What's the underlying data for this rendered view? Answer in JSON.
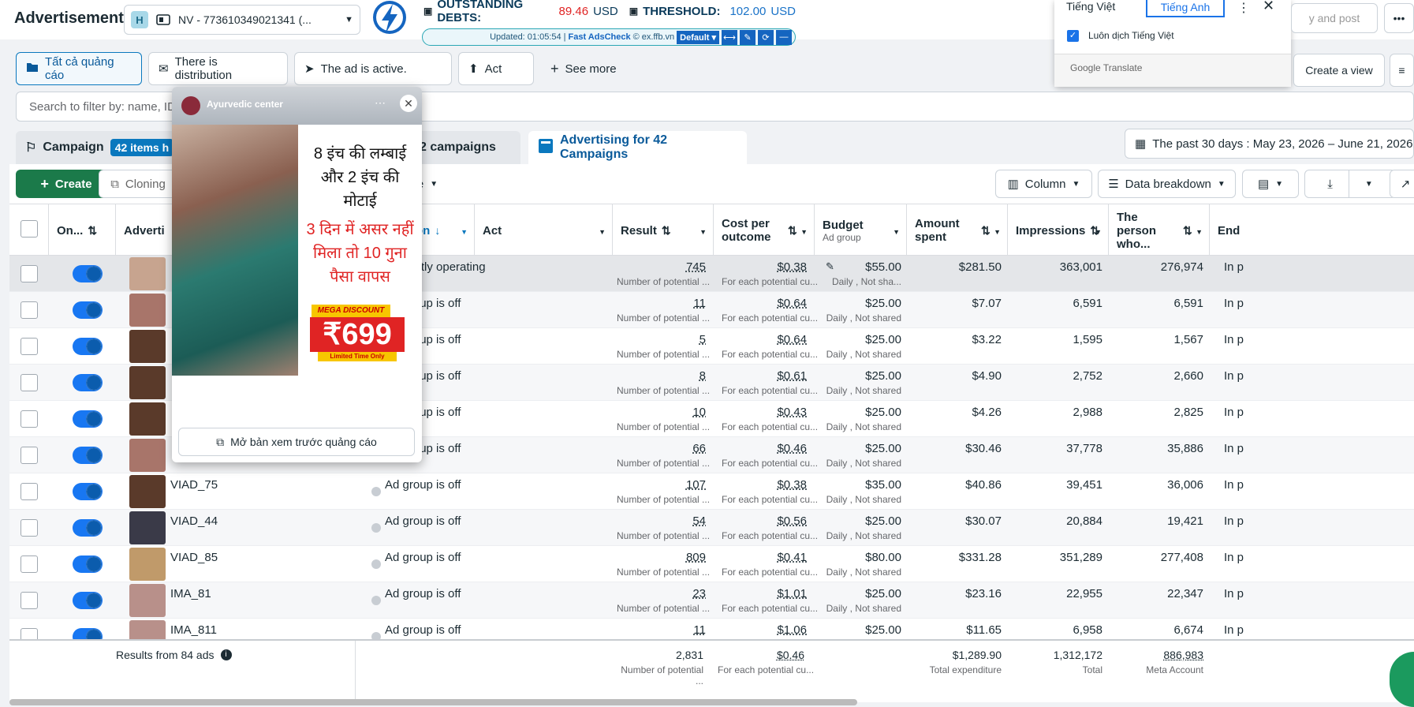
{
  "header": {
    "app_title": "Advertisement",
    "account_badge": "H",
    "account_label": "NV - 773610349021341 (...",
    "right_buttons": [
      "y and post",
      "Create a view"
    ]
  },
  "extension": {
    "debts_label": "OUTSTANDING DEBTS:",
    "debts_value": "89.46",
    "debts_currency": "USD",
    "threshold_label": "THRESHOLD:",
    "threshold_value": "102.00",
    "threshold_currency": "USD",
    "updated_text": "Updated: 01:05:54 |",
    "brand": "Fast AdsCheck",
    "copyright": "© ex.ffb.vn",
    "mode": "Default"
  },
  "translate": {
    "tab_source": "Tiếng Việt",
    "tab_target": "Tiếng Anh",
    "always_translate": "Luôn dịch Tiếng Việt",
    "footer": "Google Translate"
  },
  "filters": {
    "chips": [
      "Tất cả quảng cáo",
      "There is distribution",
      "The ad is active.",
      "Act"
    ],
    "see_more": "See more"
  },
  "search": {
    "placeholder": "Search to filter by: name, ID,..."
  },
  "tabs": {
    "campaign": "Campaign",
    "campaign_badge": "42 items h",
    "adsets": "2 campaigns",
    "ads": "Advertising for 42 Campaigns"
  },
  "date_range": "The past 30 days : May 23, 2026 – June 21, 2026",
  "toolbar": {
    "create": "Create",
    "cloning": "Cloning",
    "more_caret": "e",
    "column": "Column",
    "breakdown": "Data breakdown"
  },
  "columns": {
    "onoff": "On...",
    "ad": "Adverti",
    "distribution": "istribution",
    "act": "Act",
    "result": "Result",
    "cpo": "Cost per outcome",
    "budget": "Budget",
    "budget_sub": "Ad group",
    "spent": "Amount spent",
    "impressions": "Impressions",
    "reach": "The person who...",
    "end": "End"
  },
  "rows": [
    {
      "name": "",
      "status": "Currently operating",
      "result": "745",
      "result_sub": "Number of potential ...",
      "cpo": "$0.38",
      "cpo_sub": "For each potential cu...",
      "budget": "$55.00",
      "budget_sub": "Daily , Not sha...",
      "spent": "$281.50",
      "impr": "363,001",
      "reach": "276,974",
      "end": "In p"
    },
    {
      "name": "",
      "status": "Ad group is off",
      "result": "11",
      "result_sub": "Number of potential ...",
      "cpo": "$0.64",
      "cpo_sub": "For each potential cu...",
      "budget": "$25.00",
      "budget_sub": "Daily , Not shared",
      "spent": "$7.07",
      "impr": "6,591",
      "reach": "6,591",
      "end": "In p"
    },
    {
      "name": "",
      "status": "Ad group is off",
      "result": "5",
      "result_sub": "Number of potential ...",
      "cpo": "$0.64",
      "cpo_sub": "For each potential cu...",
      "budget": "$25.00",
      "budget_sub": "Daily , Not shared",
      "spent": "$3.22",
      "impr": "1,595",
      "reach": "1,567",
      "end": "In p"
    },
    {
      "name": "",
      "status": "Ad group is off",
      "result": "8",
      "result_sub": "Number of potential ...",
      "cpo": "$0.61",
      "cpo_sub": "For each potential cu...",
      "budget": "$25.00",
      "budget_sub": "Daily , Not shared",
      "spent": "$4.90",
      "impr": "2,752",
      "reach": "2,660",
      "end": "In p"
    },
    {
      "name": "",
      "status": "Ad group is off",
      "result": "10",
      "result_sub": "Number of potential ...",
      "cpo": "$0.43",
      "cpo_sub": "For each potential cu...",
      "budget": "$25.00",
      "budget_sub": "Daily , Not shared",
      "spent": "$4.26",
      "impr": "2,988",
      "reach": "2,825",
      "end": "In p"
    },
    {
      "name": "",
      "status": "Ad group is off",
      "result": "66",
      "result_sub": "Number of potential ...",
      "cpo": "$0.46",
      "cpo_sub": "For each potential cu...",
      "budget": "$25.00",
      "budget_sub": "Daily , Not shared",
      "spent": "$30.46",
      "impr": "37,778",
      "reach": "35,886",
      "end": "In p"
    },
    {
      "name": "VIAD_75",
      "status": "Ad group is off",
      "result": "107",
      "result_sub": "Number of potential ...",
      "cpo": "$0.38",
      "cpo_sub": "For each potential cu...",
      "budget": "$35.00",
      "budget_sub": "Daily , Not shared",
      "spent": "$40.86",
      "impr": "39,451",
      "reach": "36,006",
      "end": "In p"
    },
    {
      "name": "VIAD_44",
      "status": "Ad group is off",
      "result": "54",
      "result_sub": "Number of potential ...",
      "cpo": "$0.56",
      "cpo_sub": "For each potential cu...",
      "budget": "$25.00",
      "budget_sub": "Daily , Not shared",
      "spent": "$30.07",
      "impr": "20,884",
      "reach": "19,421",
      "end": "In p"
    },
    {
      "name": "VIAD_85",
      "status": "Ad group is off",
      "result": "809",
      "result_sub": "Number of potential ...",
      "cpo": "$0.41",
      "cpo_sub": "For each potential cu...",
      "budget": "$80.00",
      "budget_sub": "Daily , Not shared",
      "spent": "$331.28",
      "impr": "351,289",
      "reach": "277,408",
      "end": "In p"
    },
    {
      "name": "IMA_81",
      "status": "Ad group is off",
      "result": "23",
      "result_sub": "Number of potential ...",
      "cpo": "$1.01",
      "cpo_sub": "For each potential cu...",
      "budget": "$25.00",
      "budget_sub": "Daily , Not shared",
      "spent": "$23.16",
      "impr": "22,955",
      "reach": "22,347",
      "end": "In p"
    },
    {
      "name": "IMA_811",
      "status": "Ad group is off",
      "result": "11",
      "result_sub": "",
      "cpo": "$1.06",
      "cpo_sub": "",
      "budget": "$25.00",
      "budget_sub": "",
      "spent": "$11.65",
      "impr": "6,958",
      "reach": "6,674",
      "end": "In p"
    }
  ],
  "totals": {
    "label": "Results from 84 ads",
    "result": "2,831",
    "result_sub": "Number of potential ...",
    "cpo": "$0.46",
    "cpo_sub": "For each potential cu...",
    "spent": "$1,289.90",
    "spent_sub": "Total expenditure",
    "impr": "1,312,172",
    "impr_sub": "Total",
    "reach": "886,983",
    "reach_sub": "Meta Account"
  },
  "preview": {
    "page_name": "Ayurvedic center",
    "hindi_line1": "8 इंच की लम्बाई",
    "hindi_line2": "और 2 इंच की",
    "hindi_line3": "मोटाई",
    "hindi_red1": "3 दिन में असर नहीं",
    "hindi_red2": "मिला तो 10 गुना",
    "hindi_red3": "पैसा वापस",
    "mega": "MEGA DISCOUNT",
    "price": "₹699",
    "limited": "Limited Time Only",
    "open_preview": "Mở bản xem trước quảng cáo"
  },
  "colors": {
    "accent": "#0a78be",
    "create_green": "#1b7a4a",
    "debt_red": "#e02424",
    "toggle_blue": "#1877f2"
  }
}
